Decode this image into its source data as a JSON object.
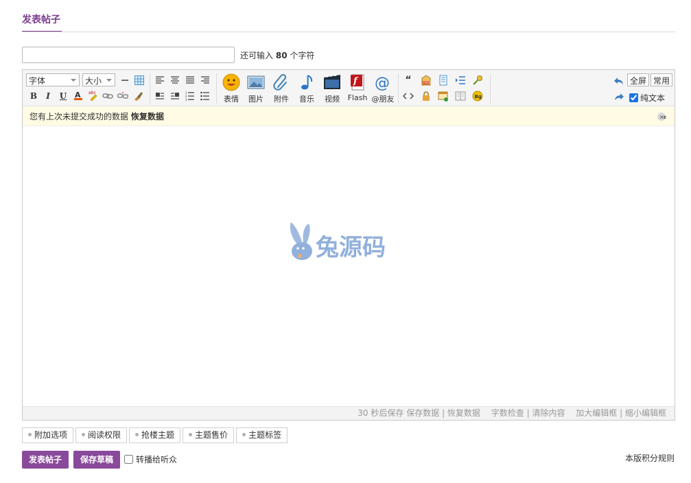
{
  "header": {
    "tab_label": "发表帖子"
  },
  "subject": {
    "value": "",
    "placeholder": "",
    "hint_prefix": "还可输入",
    "hint_count": "80",
    "hint_suffix": "个字符"
  },
  "toolbar": {
    "font_select": "字体",
    "size_select": "大小",
    "fullscreen_label": "全屏",
    "common_label": "常用",
    "plain_text_label": "纯文本",
    "plain_text_checked": true,
    "big_buttons": [
      {
        "label": "表情",
        "icon": "smiley-icon"
      },
      {
        "label": "图片",
        "icon": "image-icon"
      },
      {
        "label": "附件",
        "icon": "paperclip-icon"
      },
      {
        "label": "音乐",
        "icon": "music-icon"
      },
      {
        "label": "视频",
        "icon": "video-icon"
      },
      {
        "label": "Flash",
        "icon": "flash-icon"
      },
      {
        "label": "@朋友",
        "icon": "at-icon"
      }
    ]
  },
  "notice": {
    "text": "您有上次未提交成功的数据",
    "restore_link": "恢复数据"
  },
  "watermark": {
    "text": "兔源码"
  },
  "status_bar": {
    "autosave_seconds": "30",
    "autosave_text": "秒后保存",
    "save_data": "保存数据",
    "restore_data": "恢复数据",
    "word_check": "字数检查",
    "clear_content": "清除内容",
    "enlarge": "加大编辑框",
    "shrink": "缩小编辑框"
  },
  "option_tabs": [
    "附加选项",
    "阅读权限",
    "抢楼主题",
    "主题售价",
    "主题标签"
  ],
  "actions": {
    "submit_label": "发表帖子",
    "draft_label": "保存草稿",
    "broadcast_label": "转播给听众",
    "rules_link": "本版积分规则"
  },
  "colors": {
    "brand": "#8a4a9b",
    "notice_bg": "#fffbe4",
    "toolbar_bg": "#f5f5f5"
  }
}
